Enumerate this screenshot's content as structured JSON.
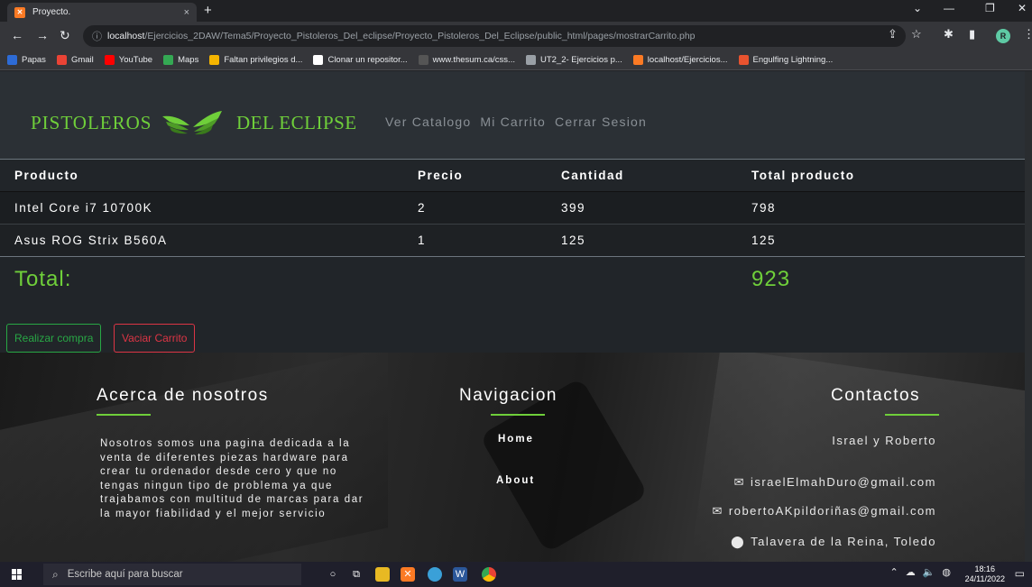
{
  "browser": {
    "tab_title": "Proyecto.",
    "tab_close": "×",
    "new_tab": "+",
    "url_host": "localhost",
    "url_path": "/Ejercicios_2DAW/Tema5/Proyecto_Pistoleros_Del_eclipse/Proyecto_Pistoleros_Del_Eclipse/public_html/pages/mostrarCarrito.php",
    "profile_initial": "R",
    "bookmarks": [
      {
        "label": "Papas",
        "color": "#2d6bd6"
      },
      {
        "label": "Gmail",
        "color": "#ea4335"
      },
      {
        "label": "YouTube",
        "color": "#ff0000"
      },
      {
        "label": "Maps",
        "color": "#34a853"
      },
      {
        "label": "Faltan privilegios d...",
        "color": "#f4b400"
      },
      {
        "label": "Clonar un repositor...",
        "color": "#ffffff"
      },
      {
        "label": "www.thesum.ca/css...",
        "color": "#555555"
      },
      {
        "label": "UT2_2- Ejercicios p...",
        "color": "#9aa0a6"
      },
      {
        "label": "localhost/Ejercicios...",
        "color": "#fb7a24"
      },
      {
        "label": "Engulfing Lightning...",
        "color": "#e8532f"
      }
    ]
  },
  "navbar": {
    "brand_left": "PISTOLEROS",
    "brand_right": "DEL ECLIPSE",
    "links": [
      "Ver Catalogo",
      "Mi Carrito",
      "Cerrar Sesion"
    ]
  },
  "cart": {
    "headers": [
      "Producto",
      "Precio",
      "Cantidad",
      "Total producto"
    ],
    "rows": [
      [
        "Intel Core i7 10700K",
        "2",
        "399",
        "798"
      ],
      [
        "Asus ROG Strix B560A",
        "1",
        "125",
        "125"
      ]
    ],
    "total_label": "Total:",
    "total_value": "923",
    "buy_button": "Realizar compra",
    "empty_button": "Vaciar Carrito"
  },
  "footer": {
    "about_title": "Acerca de nosotros",
    "about_text": "Nosotros somos una pagina dedicada a la venta de diferentes piezas hardware para crear tu ordenador desde cero y que no tengas ningun tipo de problema ya que trajabamos con multitud de marcas para dar la mayor fiabilidad y el mejor servicio",
    "nav_title": "Navigacion",
    "nav_links": [
      "Home",
      "About"
    ],
    "contact_title": "Contactos",
    "contact_names": "Israel y Roberto",
    "email1": "israelElmahDuro@gmail.com",
    "email2": "robertoAKpildoriñas@gmail.com",
    "location": "Talavera de la Reina, Toledo",
    "accent_color": "#6fcf3a"
  },
  "taskbar": {
    "search_placeholder": "Escribe aquí para buscar",
    "time": "18:16",
    "date": "24/11/2022"
  }
}
